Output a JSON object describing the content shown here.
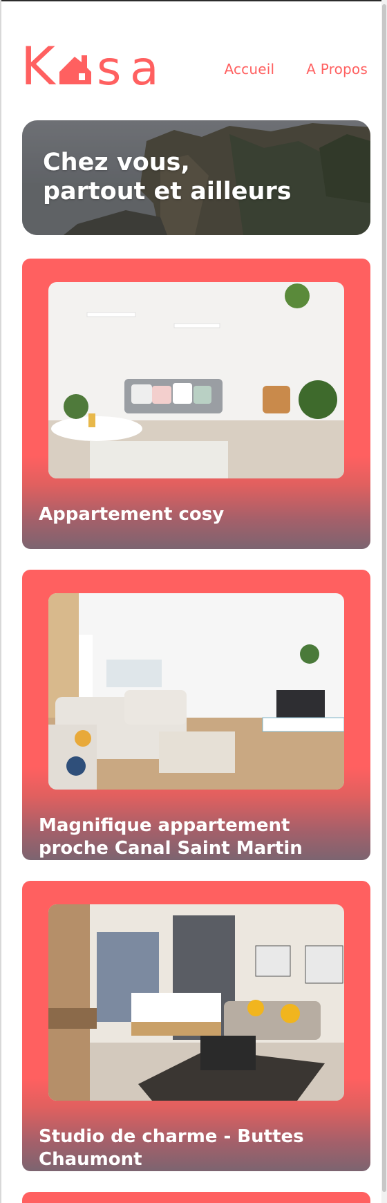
{
  "brand": {
    "logo_letters": [
      "K",
      "s",
      "a"
    ],
    "logo_name": "Kasa",
    "accent": "#ff6060"
  },
  "nav": {
    "items": [
      {
        "label": "Accueil"
      },
      {
        "label": "A Propos"
      }
    ]
  },
  "banner": {
    "line1": "Chez vous,",
    "line2": "partout et ailleurs"
  },
  "cards": [
    {
      "title": "Appartement cosy"
    },
    {
      "title": "Magnifique appartement proche Canal Saint Martin"
    },
    {
      "title": "Studio de charme - Buttes Chaumont"
    }
  ]
}
